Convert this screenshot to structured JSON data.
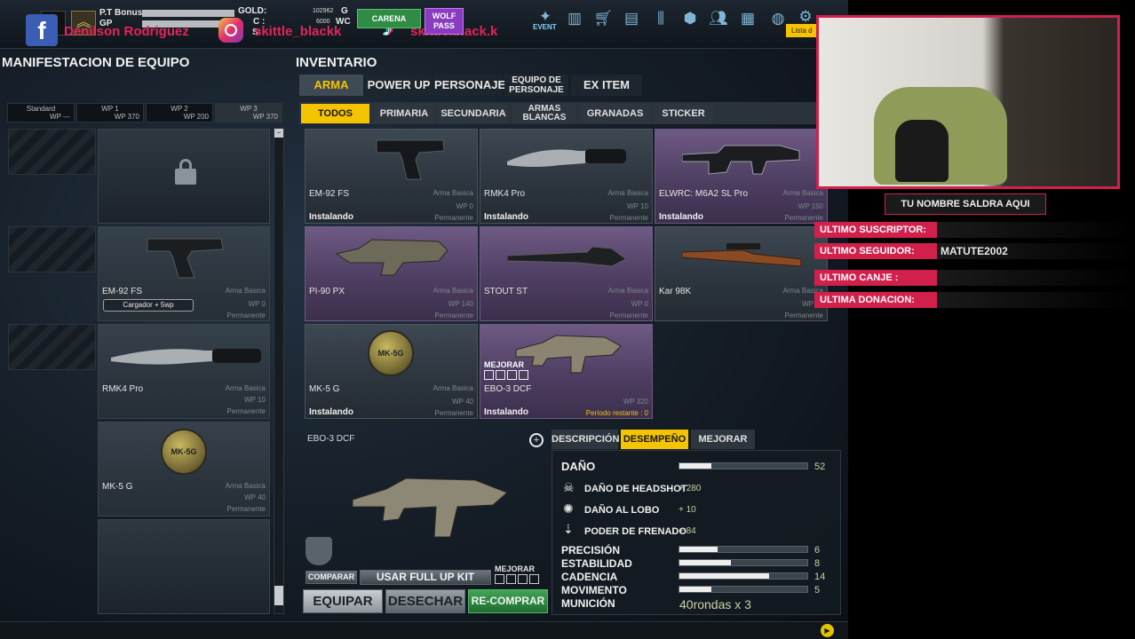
{
  "topbar": {
    "pt_bonus_label": "P.T Bonus",
    "gp_label": "GP",
    "gold_label": "GOLD:",
    "gold_unit": "G",
    "c_label": "C :",
    "c_unit": "WC",
    "c_value": "6000",
    "gold_value": "102962",
    "third_label": "S:",
    "facebook_name": "Denilson Rodriguez",
    "instagram_name": "skittle_blackk",
    "tiktok_name": "skittle.black.k",
    "green_button": "CARENA",
    "wolf_pass": "WOLF PASS",
    "event_label": "EVENT",
    "list_label": "Lista d"
  },
  "left": {
    "title": "MANIFESTACION DE EQUIPO",
    "wp_tabs": [
      {
        "name": "Standard",
        "wp": "WP ---"
      },
      {
        "name": "WP 1",
        "wp": "WP 370"
      },
      {
        "name": "WP 2",
        "wp": "WP 200"
      },
      {
        "name": "WP 3",
        "wp": "WP 370"
      }
    ],
    "slots": [
      {
        "name": "",
        "type": "",
        "wp": "",
        "perm": ""
      },
      {
        "name": "EM-92 FS",
        "type": "Arma Basica",
        "wp": "WP 0",
        "perm": "Permanente",
        "extra": "Cargador + 5wp"
      },
      {
        "name": "RMK4 Pro",
        "type": "Arma Basica",
        "wp": "WP 10",
        "perm": "Permanente"
      },
      {
        "name": "MK-5 G",
        "type": "Arma Basica",
        "wp": "WP 40",
        "perm": "Permanente"
      },
      {
        "name": "",
        "type": "",
        "wp": "",
        "perm": ""
      }
    ]
  },
  "inventory": {
    "title": "INVENTARIO",
    "categories": [
      "ARMA",
      "POWER UP",
      "PERSONAJE",
      "EQUIPO DE PERSONAJE",
      "EX ITEM"
    ],
    "subtabs": [
      "TODOS",
      "PRIMARIA",
      "SECUNDARIA",
      "ARMAS BLANCAS",
      "GRANADAS",
      "STICKER"
    ],
    "items": [
      {
        "name": "EM-92 FS",
        "type": "Arma Basica",
        "wp": "WP 0",
        "perm": "Permanente",
        "status": "Instalando",
        "purple": false
      },
      {
        "name": "RMK4 Pro",
        "type": "Arma Basica",
        "wp": "WP 10",
        "perm": "Permanente",
        "status": "Instalando",
        "purple": false
      },
      {
        "name": "ELWRC: M6A2 SL Pro",
        "type": "Arma Basica",
        "wp": "WP 150",
        "perm": "Permanente",
        "status": "Instalando",
        "purple": true
      },
      {
        "name": "PI-90 PX",
        "type": "Arma Basica",
        "wp": "WP 140",
        "perm": "Permanente",
        "status": "",
        "purple": true
      },
      {
        "name": "STOUT ST",
        "type": "Arma Basica",
        "wp": "WP 0",
        "perm": "Permanente",
        "status": "",
        "purple": true
      },
      {
        "name": "Kar 98K",
        "type": "Arma Basica",
        "wp": "WP 10",
        "perm": "Permanente",
        "status": "",
        "purple": false
      },
      {
        "name": "MK-5 G",
        "type": "Arma Basica",
        "wp": "WP 40",
        "perm": "Permanente",
        "status": "Instalando",
        "purple": false
      },
      {
        "name": "EBO-3 DCF",
        "type": "",
        "wp": "WP 320",
        "perm": "Período restante : 0",
        "status": "Instalando",
        "purple": true,
        "mejorar": "MEJORAR"
      }
    ]
  },
  "detail": {
    "weapon_name": "EBO-3 DCF",
    "info_tabs": [
      "DESCRIPCIÓN",
      "DESEMPEÑO",
      "MEJORAR"
    ],
    "damage_label": "DAÑO",
    "damage_value": "52",
    "damage_fraction": 0.25,
    "sub_stats": [
      {
        "label": "DAÑO DE HEADSHOT",
        "value": "+ 280"
      },
      {
        "label": "DAÑO AL LOBO",
        "value": "+ 10"
      },
      {
        "label": "PODER DE FRENADO",
        "value": "+ 84"
      }
    ],
    "stats": [
      {
        "label": "PRECISIÓN",
        "value": "6",
        "fraction": 0.3
      },
      {
        "label": "ESTABILIDAD",
        "value": "8",
        "fraction": 0.4
      },
      {
        "label": "CADENCIA",
        "value": "14",
        "fraction": 0.7
      },
      {
        "label": "MOVIMENTO",
        "value": "5",
        "fraction": 0.25
      }
    ],
    "ammo_label": "MUNICIÓN",
    "ammo_value": "40rondas x 3",
    "compare_btn": "COMPARAR",
    "kit_btn": "USAR FULL UP KIT",
    "mejorar_label": "MEJORAR",
    "equip_btn": "EQUIPAR",
    "discard_btn": "DESECHAR",
    "rebuy_btn": "RE-COMPRAR"
  },
  "overlay": {
    "name_box": "TU NOMBRE SALDRA AQUI",
    "labels": [
      "ULTIMO SUSCRIPTOR:",
      "ULTIMO SEGUIDOR:",
      "ULTIMO CANJE :",
      "ULTIMA DONACION:"
    ],
    "follower_value": "MATUTE2002"
  },
  "colors": {
    "accent": "#f5c400",
    "overlay": "#d2204d",
    "purple_card": "#5a4872",
    "green_button": "#2f8c45"
  }
}
